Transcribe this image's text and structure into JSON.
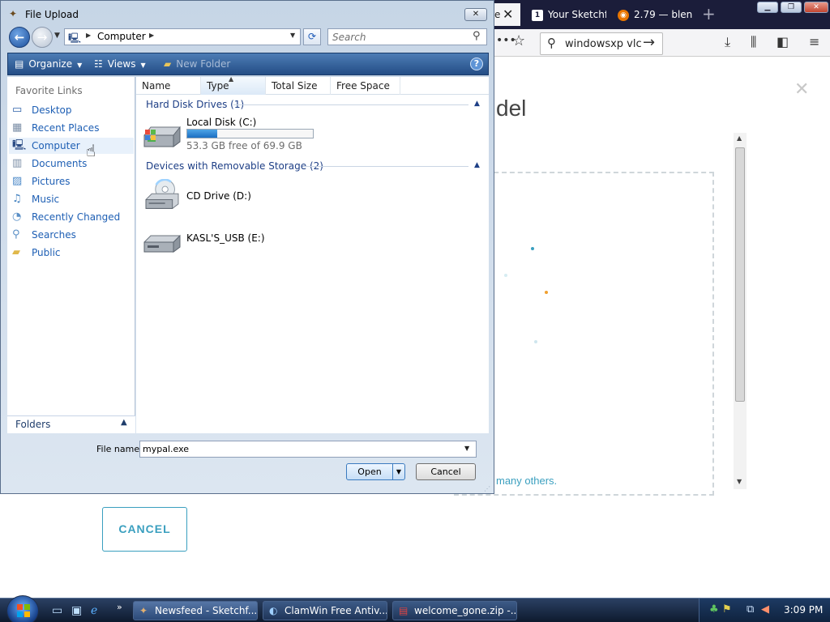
{
  "background_firefox": {
    "tabs": [
      {
        "label": "e",
        "close": "✕"
      },
      {
        "favicon": "1",
        "label": "Your Sketchf"
      },
      {
        "favicon": "",
        "label": "2.79 — blen"
      }
    ],
    "new_tab": "+",
    "url_text": "windowsxp vlc",
    "heading_fragment": "del",
    "footer_fragment": "many others.",
    "cancel_label": "CANCEL",
    "dot_colors": [
      "#3a9fbf",
      "#f0a030",
      "#d6ecf2",
      "#cfe6ee"
    ]
  },
  "dialog": {
    "title": "File Upload",
    "address": {
      "location": "Computer"
    },
    "search": {
      "placeholder": "Search"
    },
    "command_bar": {
      "organize": "Organize",
      "views": "Views",
      "new_folder": "New Folder",
      "help": "?"
    },
    "favorite_links": {
      "header": "Favorite Links",
      "items": [
        {
          "label": "Desktop",
          "icon": "desktop-icon"
        },
        {
          "label": "Recent Places",
          "icon": "recent-places-icon"
        },
        {
          "label": "Computer",
          "icon": "computer-icon",
          "selected": true
        },
        {
          "label": "Documents",
          "icon": "documents-icon"
        },
        {
          "label": "Pictures",
          "icon": "pictures-icon"
        },
        {
          "label": "Music",
          "icon": "music-icon"
        },
        {
          "label": "Recently Changed",
          "icon": "recently-changed-icon"
        },
        {
          "label": "Searches",
          "icon": "searches-icon"
        },
        {
          "label": "Public",
          "icon": "public-folder-icon"
        }
      ]
    },
    "folders_label": "Folders",
    "columns": [
      "Name",
      "Type",
      "Total Size",
      "Free Space"
    ],
    "groups": {
      "hard_disks": {
        "title": "Hard Disk Drives (1)",
        "drives": [
          {
            "name": "Local Disk (C:)",
            "free_text": "53.3 GB free of 69.9 GB",
            "used_fraction": 0.24
          }
        ]
      },
      "removable": {
        "title": "Devices with Removable Storage (2)",
        "drives": [
          {
            "name": "CD Drive (D:)"
          },
          {
            "name": "KASL'S_USB (E:)"
          }
        ]
      }
    },
    "file_name": {
      "label": "File name:",
      "value": "mypal.exe"
    },
    "buttons": {
      "open": "Open",
      "cancel": "Cancel"
    }
  },
  "taskbar": {
    "tasks": [
      {
        "label": "Newsfeed - Sketchf..."
      },
      {
        "label": "ClamWin Free Antiv..."
      },
      {
        "label": "welcome_gone.zip -..."
      }
    ],
    "quick_launch_more": "»",
    "clock": "3:09 PM"
  }
}
